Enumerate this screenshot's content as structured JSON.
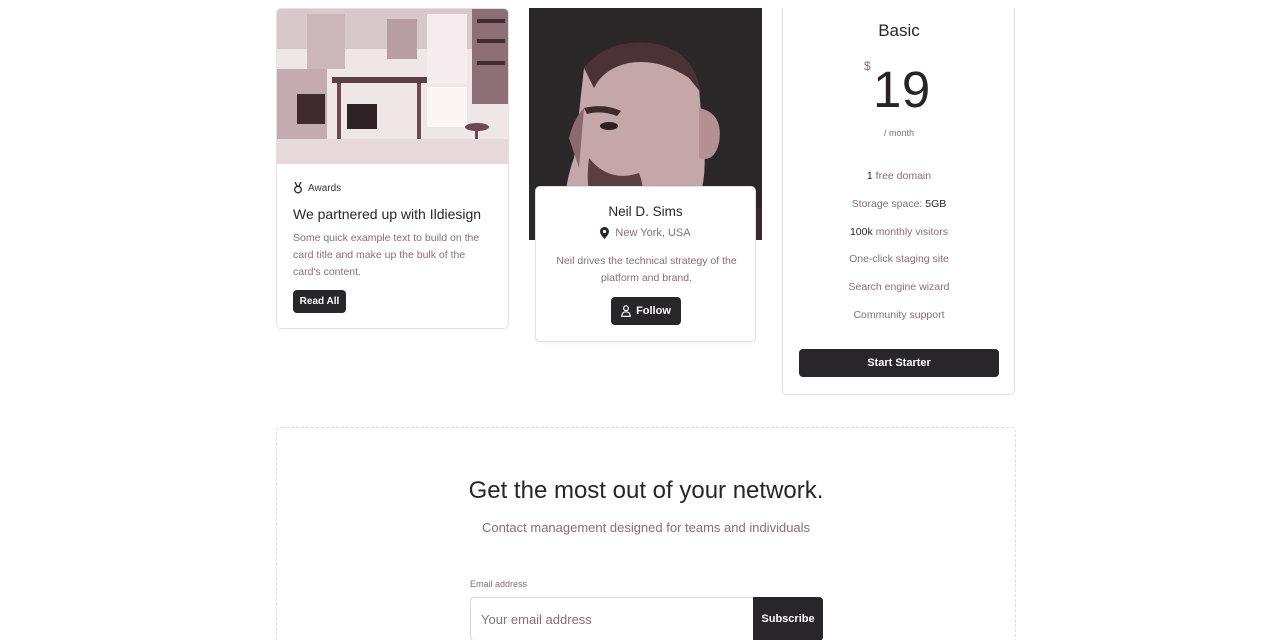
{
  "blog_card": {
    "tag": "Awards",
    "title": "We partnered up with Ildiesign",
    "text": "Some quick example text to build on the card title and make up the bulk of the card's content.",
    "button": "Read All"
  },
  "profile_card": {
    "name": "Neil D. Sims",
    "location": "New York, USA",
    "text": "Neil drives the technical strategy of the platform and brand.",
    "button": "Follow"
  },
  "pricing_card": {
    "plan": "Basic",
    "currency": "$",
    "price": "19",
    "period": "/ month",
    "features": [
      {
        "strong": "1",
        "text": " free domain"
      },
      {
        "text": "Storage space: ",
        "strong_after": "5GB"
      },
      {
        "strong": "100k",
        "text": " monthly visitors"
      },
      {
        "text": "One-click staging site"
      },
      {
        "text": "Search engine wizard"
      },
      {
        "text": "Community support"
      }
    ],
    "button": "Start Starter"
  },
  "newsletter": {
    "title": "Get the most out of your network.",
    "subtitle": "Contact management designed for teams and individuals",
    "email_label": "Email address",
    "email_placeholder": "Your email address",
    "button": "Subscribe"
  },
  "colors": {
    "dark": "#28252b",
    "muted_text": "#8a6d72"
  }
}
